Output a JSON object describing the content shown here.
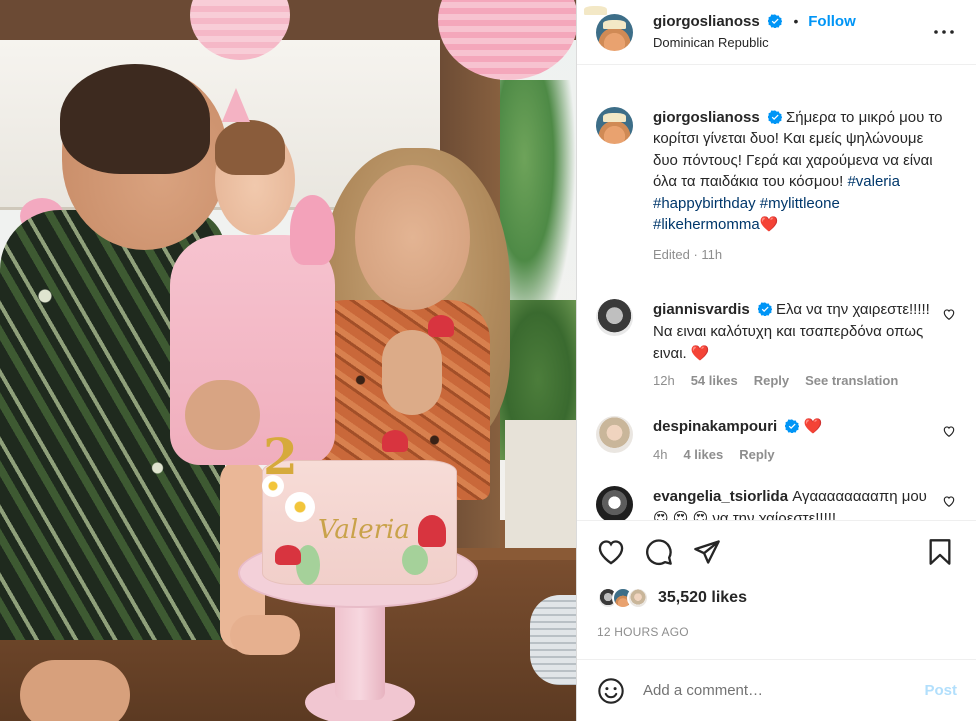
{
  "post": {
    "username": "giorgoslianoss",
    "location": "Dominican Republic",
    "follow_label": "Follow",
    "separator": "•",
    "cake_text": "Valeria",
    "cake_topper": "2"
  },
  "caption": {
    "username": "giorgoslianoss",
    "text": "Σήμερα το μικρό μου το κορίτσι γίνεται δυο! Και εμείς ψηλώνουμε δυο πόντους! Γερά και χαρούμενα να είναι όλα τα παιδάκια του κόσμου!",
    "hashtags": [
      "#valeria",
      "#happybirthday",
      "#mylittleone",
      "#likehermomma"
    ],
    "emoji": "❤️",
    "meta": "Edited · 11h"
  },
  "comments": [
    {
      "username": "giannisvardis",
      "verified": true,
      "text": "Ελα να την χαιρεστε!!!!! Να ειναι καλότυχη και τσαπερδόνα οπως ειναι.",
      "emoji": "❤️",
      "time": "12h",
      "likes": "54 likes",
      "reply": "Reply",
      "translate": "See translation"
    },
    {
      "username": "despinakampouri",
      "verified": true,
      "text": "",
      "emoji": "❤️",
      "time": "4h",
      "likes": "4 likes",
      "reply": "Reply"
    },
    {
      "username": "evangelia_tsiorlida",
      "verified": false,
      "text": "Αγααααααααπη μου",
      "emoji": "😍 😍 😍",
      "text_after": "να την χαίρεστε!!!!!"
    }
  ],
  "likes_label": "35,520 likes",
  "timestamp": "12 HOURS AGO",
  "add_comment": {
    "placeholder": "Add a comment…",
    "post_label": "Post"
  },
  "colors": {
    "link": "#0095f6",
    "hashtag": "#00376b",
    "muted": "#8e8e8e",
    "post_disabled": "#b2dffc",
    "heart": "#ed1c24"
  },
  "icons": [
    "verified-icon",
    "more-options-icon",
    "heart-icon",
    "comment-icon",
    "share-icon",
    "bookmark-icon",
    "emoji-icon"
  ]
}
